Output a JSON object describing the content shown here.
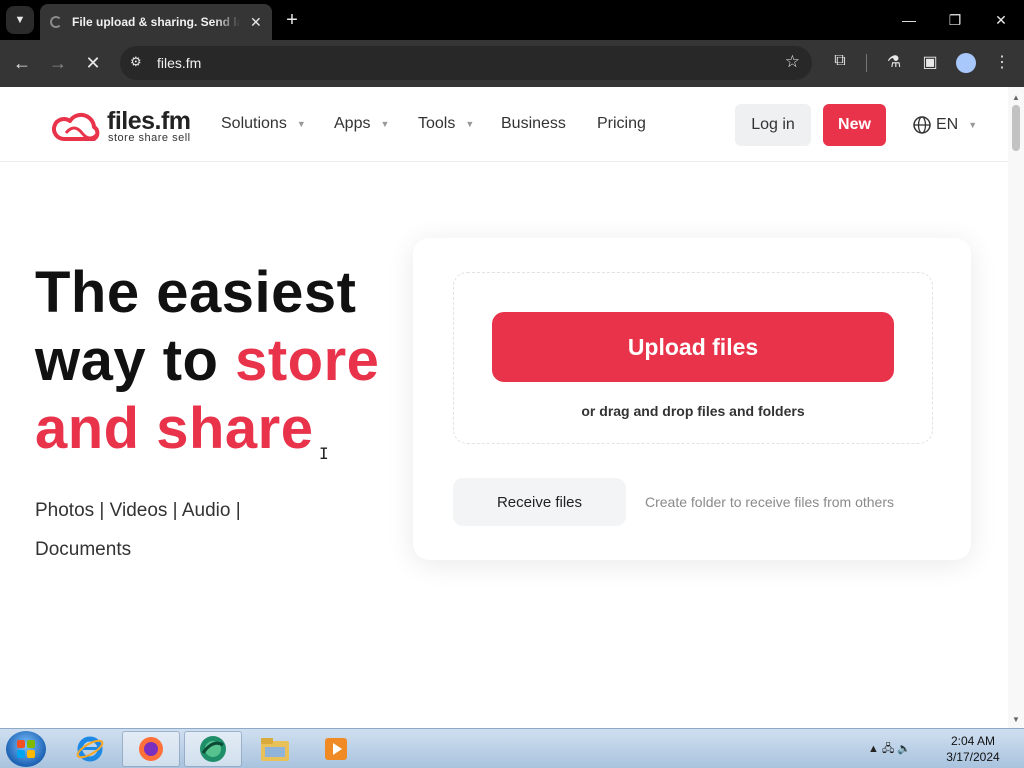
{
  "browser": {
    "tab_title": "File upload & sharing. Send large files",
    "url": "files.fm",
    "tab_close": "✕",
    "new_tab": "+",
    "minimize": "—",
    "maximize": "❐",
    "close": "✕"
  },
  "site": {
    "logo_name": "files.fm",
    "logo_tagline": "store  share  sell",
    "nav": {
      "solutions": "Solutions",
      "apps": "Apps",
      "tools": "Tools",
      "business": "Business",
      "pricing": "Pricing"
    },
    "login": "Log in",
    "new": "New",
    "language": "EN",
    "brand_color": "#e8334a"
  },
  "hero": {
    "line1": "The easiest",
    "line2_plain": "way to ",
    "line2_accent": "store",
    "line3_accent": "and share",
    "categories": "Photos  |  Videos  |  Audio  |  Documents"
  },
  "upload": {
    "button": "Upload files",
    "drop_hint": "or drag and drop files and folders",
    "receive_button": "Receive files",
    "receive_hint": "Create folder to receive files from others"
  },
  "taskbar": {
    "time": "2:04 AM",
    "date": "3/17/2024"
  }
}
